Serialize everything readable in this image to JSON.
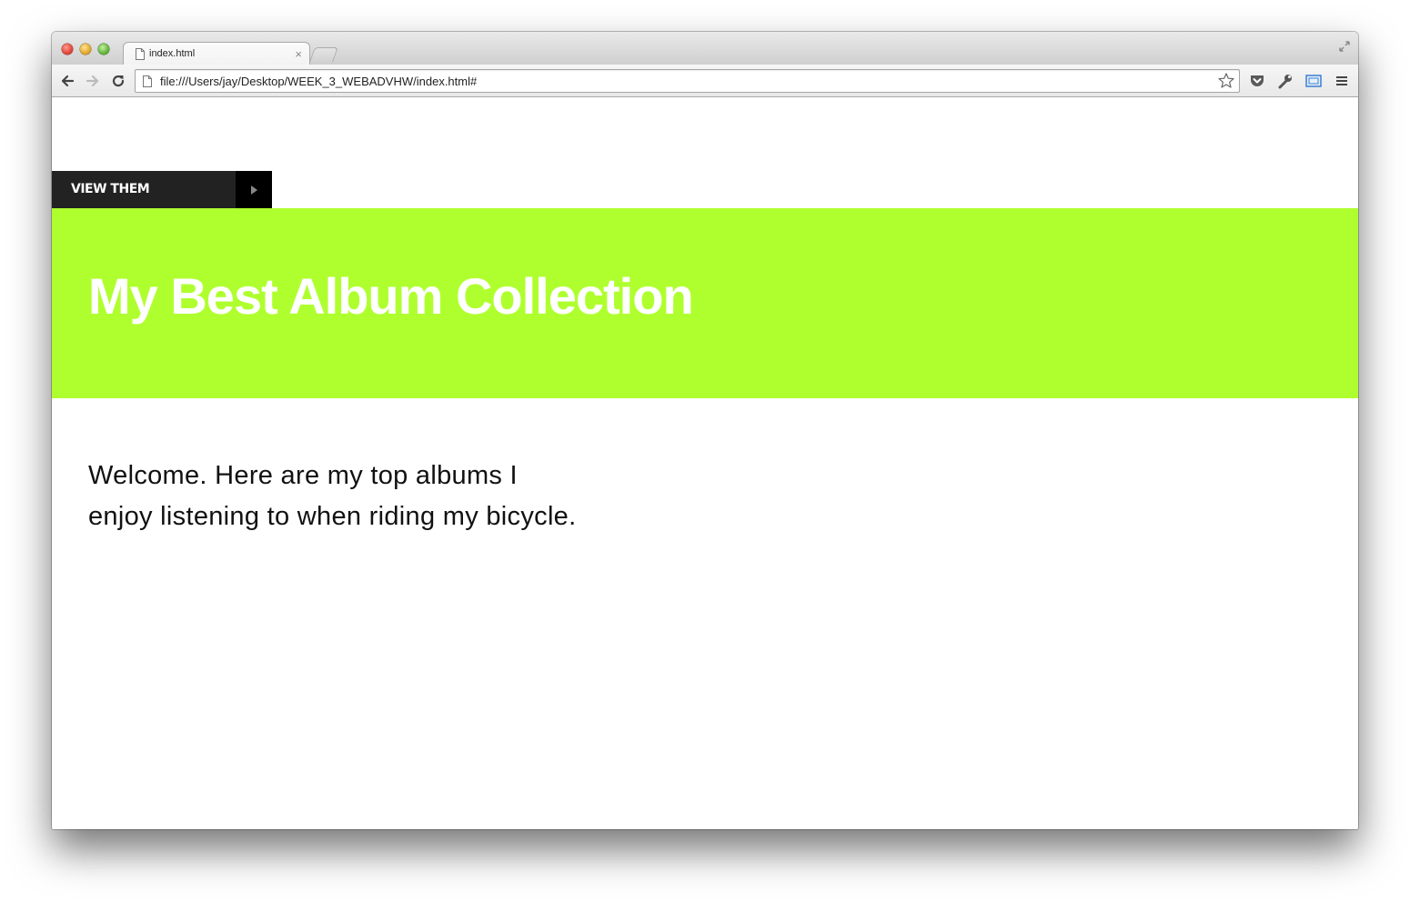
{
  "browser": {
    "tab": {
      "title": "index.html",
      "close_glyph": "×"
    },
    "address_bar": {
      "url": "file:///Users/jay/Desktop/WEEK_3_WEBADVHW/index.html#"
    },
    "icons": [
      "back-arrow-icon",
      "forward-arrow-icon",
      "reload-icon",
      "page-icon",
      "star-icon",
      "pocket-icon",
      "wrench-icon",
      "screen-icon",
      "menu-icon",
      "fullscreen-icon"
    ]
  },
  "page": {
    "view_button": {
      "label": "VIEW THEM"
    },
    "hero": {
      "title": "My Best Album Collection",
      "background": "#afff2f"
    },
    "intro": {
      "line1": "Welcome. Here are my top albums I",
      "line2": "enjoy listening to when riding my bicycle."
    }
  }
}
